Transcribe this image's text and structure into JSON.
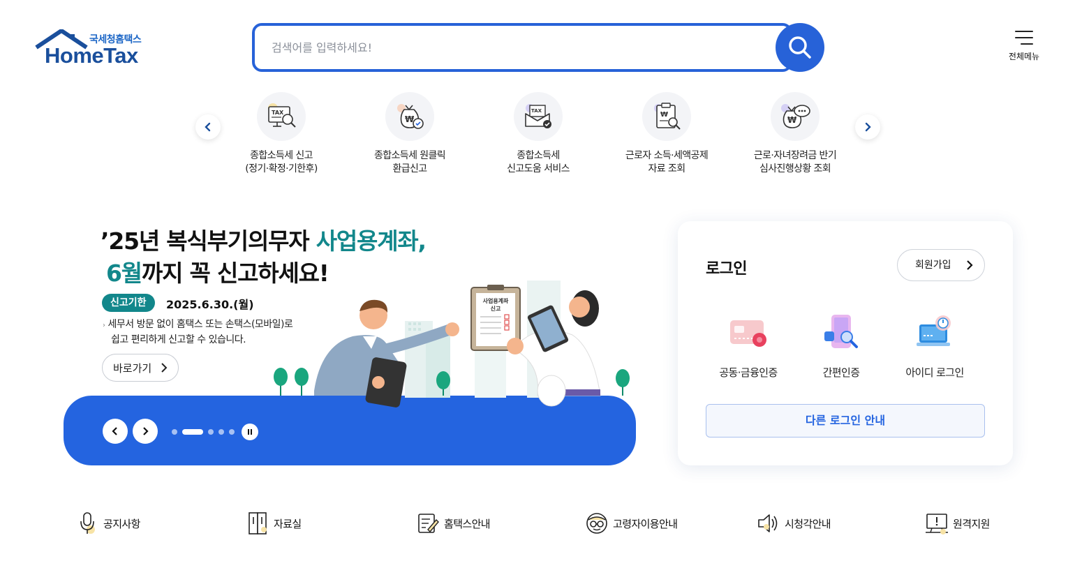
{
  "header": {
    "brand_sub": "국세청홈택스",
    "brand_main": "HomeTax",
    "search_placeholder": "검색어를 입력하세요!",
    "all_menu_label": "전체메뉴"
  },
  "quick_services": [
    {
      "label": "종합소득세 신고\n(정기·확정·기한후)",
      "icon": "tax-monitor-search-icon"
    },
    {
      "label": "종합소득세 원클릭\n환급신고",
      "icon": "money-bag-check-icon"
    },
    {
      "label": "종합소득세\n신고도움 서비스",
      "icon": "tax-envelope-check-icon"
    },
    {
      "label": "근로자 소득·세액공제\n자료 조회",
      "icon": "document-won-search-icon"
    },
    {
      "label": "근로·자녀장려금 반기\n심사진행상황 조회",
      "icon": "money-bag-chat-icon"
    }
  ],
  "banner": {
    "title_line1_a": "’25년 복식부기의무자 ",
    "title_line1_b": "사업용계좌,",
    "title_line2_a": "6월",
    "title_line2_b": "까지 꼭 신고하세요!",
    "badge": "신고기한",
    "date": "2025.6.30.(월)",
    "desc_line1": "세무서 방문 없이 홈택스 또는 손택스(모바일)로",
    "desc_line2": "쉽고 편리하게 신고할 수 있습니다.",
    "go_label": "바로가기",
    "clipboard_text1": "사업용계좌",
    "clipboard_text2": "신고",
    "slide_count": 5,
    "active_slide_index": 1
  },
  "login": {
    "title": "로그인",
    "join_label": "회원가입",
    "options": [
      {
        "label": "공동·금융인증",
        "icon": "certificate-card-icon"
      },
      {
        "label": "간편인증",
        "icon": "phone-search-icon"
      },
      {
        "label": "아이디 로그인",
        "icon": "laptop-power-icon"
      }
    ],
    "other_label": "다른 로그인 안내"
  },
  "footer_links": [
    {
      "label": "공지사항",
      "icon": "microphone-icon"
    },
    {
      "label": "자료실",
      "icon": "archive-icon"
    },
    {
      "label": "홈택스안내",
      "icon": "notepad-pen-icon"
    },
    {
      "label": "고령자이용안내",
      "icon": "elderly-glasses-icon"
    },
    {
      "label": "시청각안내",
      "icon": "speaker-icon"
    },
    {
      "label": "원격지원",
      "icon": "remote-monitor-icon"
    }
  ],
  "colors": {
    "primary_blue": "#2464e0",
    "teal": "#12878b",
    "logo_blue": "#1a4f9c"
  }
}
